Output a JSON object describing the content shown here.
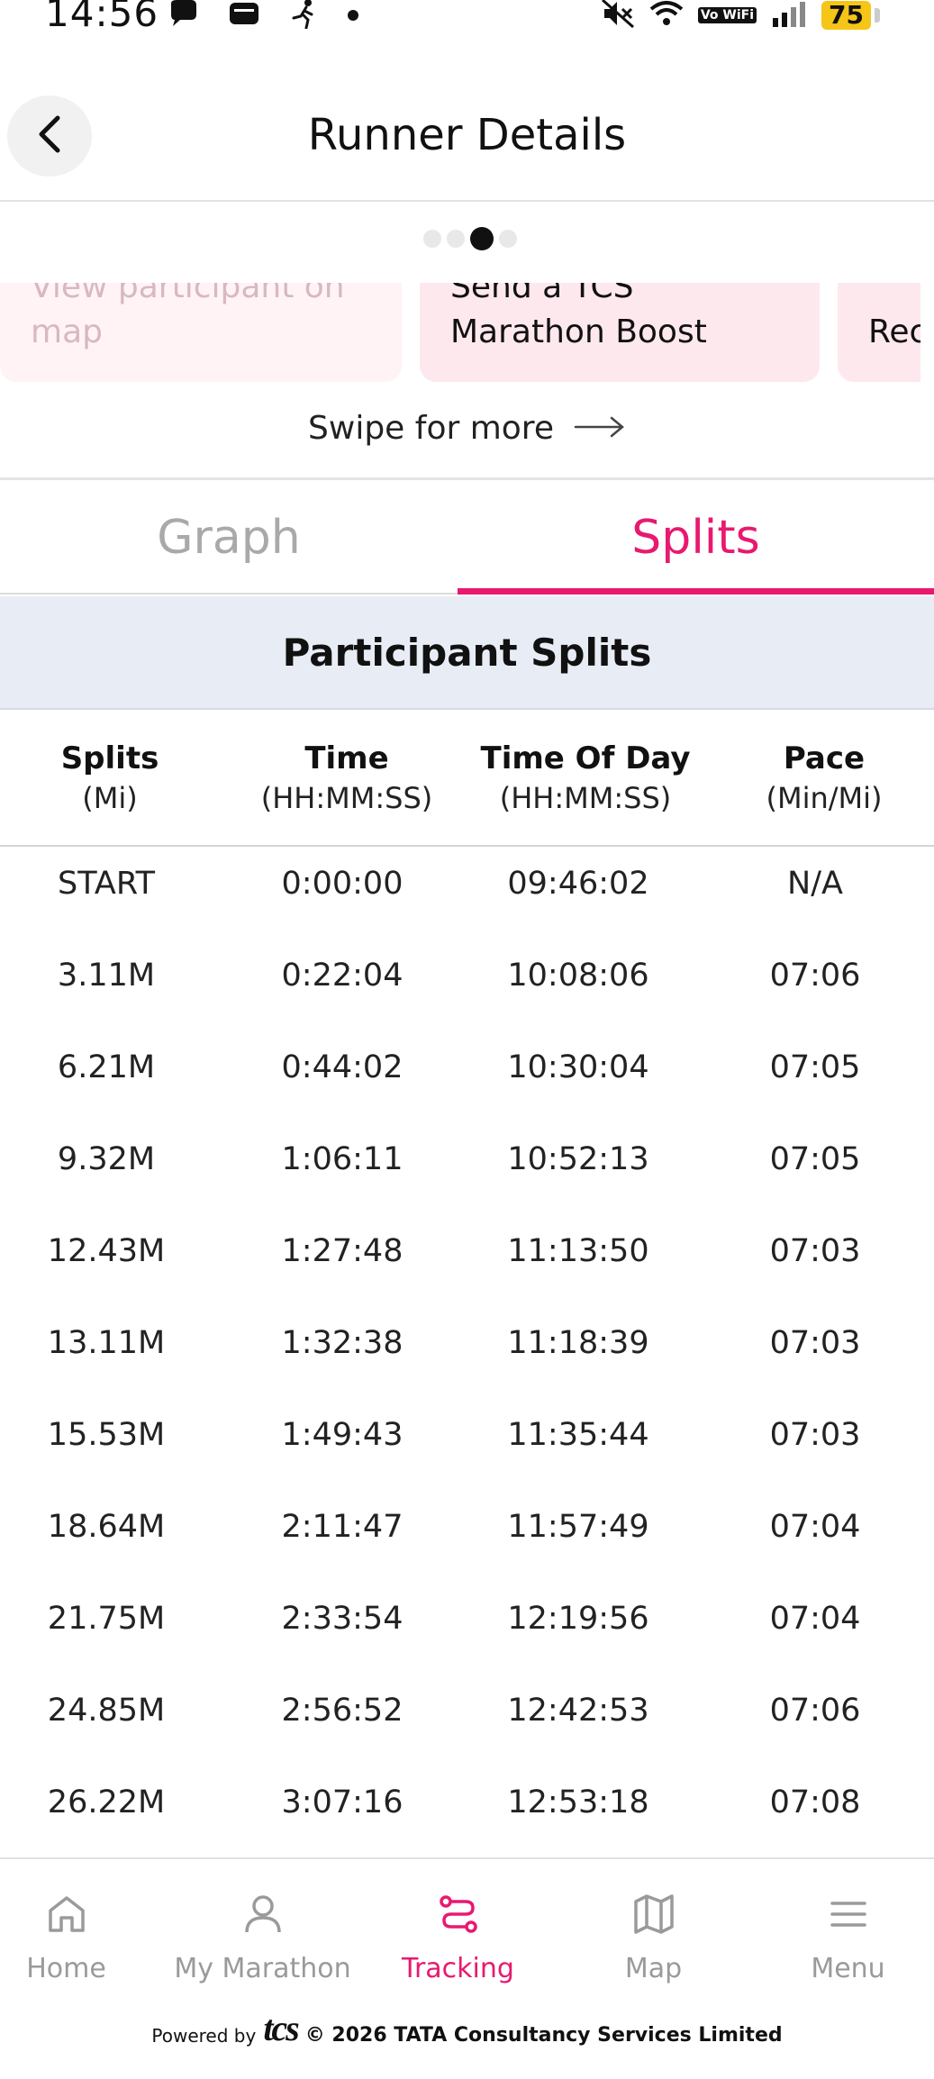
{
  "status_bar": {
    "time": "14:56",
    "battery": "75",
    "network_label": "Vo WiFi"
  },
  "header": {
    "title": "Runner Details"
  },
  "pager": {
    "total": 4,
    "active_index": 2
  },
  "cards": [
    {
      "label": "View participant on map"
    },
    {
      "label": "Send a TCS Marathon Boost"
    },
    {
      "label": "Rec view"
    }
  ],
  "swipe_hint": "Swipe for more",
  "tabs": [
    {
      "label": "Graph",
      "active": false
    },
    {
      "label": "Splits",
      "active": true
    }
  ],
  "splits": {
    "title": "Participant Splits",
    "columns": [
      {
        "title": "Splits",
        "sub": "(Mi)"
      },
      {
        "title": "Time",
        "sub": "(HH:MM:SS)"
      },
      {
        "title": "Time Of Day",
        "sub": "(HH:MM:SS)"
      },
      {
        "title": "Pace",
        "sub": "(Min/Mi)"
      }
    ],
    "rows": [
      [
        "START",
        "0:00:00",
        "09:46:02",
        "N/A"
      ],
      [
        "3.11M",
        "0:22:04",
        "10:08:06",
        "07:06"
      ],
      [
        "6.21M",
        "0:44:02",
        "10:30:04",
        "07:05"
      ],
      [
        "9.32M",
        "1:06:11",
        "10:52:13",
        "07:05"
      ],
      [
        "12.43M",
        "1:27:48",
        "11:13:50",
        "07:03"
      ],
      [
        "13.11M",
        "1:32:38",
        "11:18:39",
        "07:03"
      ],
      [
        "15.53M",
        "1:49:43",
        "11:35:44",
        "07:03"
      ],
      [
        "18.64M",
        "2:11:47",
        "11:57:49",
        "07:04"
      ],
      [
        "21.75M",
        "2:33:54",
        "12:19:56",
        "07:04"
      ],
      [
        "24.85M",
        "2:56:52",
        "12:42:53",
        "07:06"
      ],
      [
        "26.22M",
        "3:07:16",
        "12:53:18",
        "07:08"
      ]
    ]
  },
  "bottom_nav": [
    {
      "label": "Home",
      "icon": "home-icon",
      "active": false
    },
    {
      "label": "My Marathon",
      "icon": "person-icon",
      "active": false
    },
    {
      "label": "Tracking",
      "icon": "route-icon",
      "active": true
    },
    {
      "label": "Map",
      "icon": "map-icon",
      "active": false
    },
    {
      "label": "Menu",
      "icon": "hamburger-icon",
      "active": false
    }
  ],
  "footer": {
    "powered_by": "Powered by",
    "logo_text": "tcs",
    "copyright": "© 2026 TATA Consultancy Services Limited"
  },
  "colors": {
    "accent": "#e8196f",
    "card_bg": "#fde8ee",
    "banner_bg": "#e8edf5",
    "inactive": "#9a9a9a"
  }
}
